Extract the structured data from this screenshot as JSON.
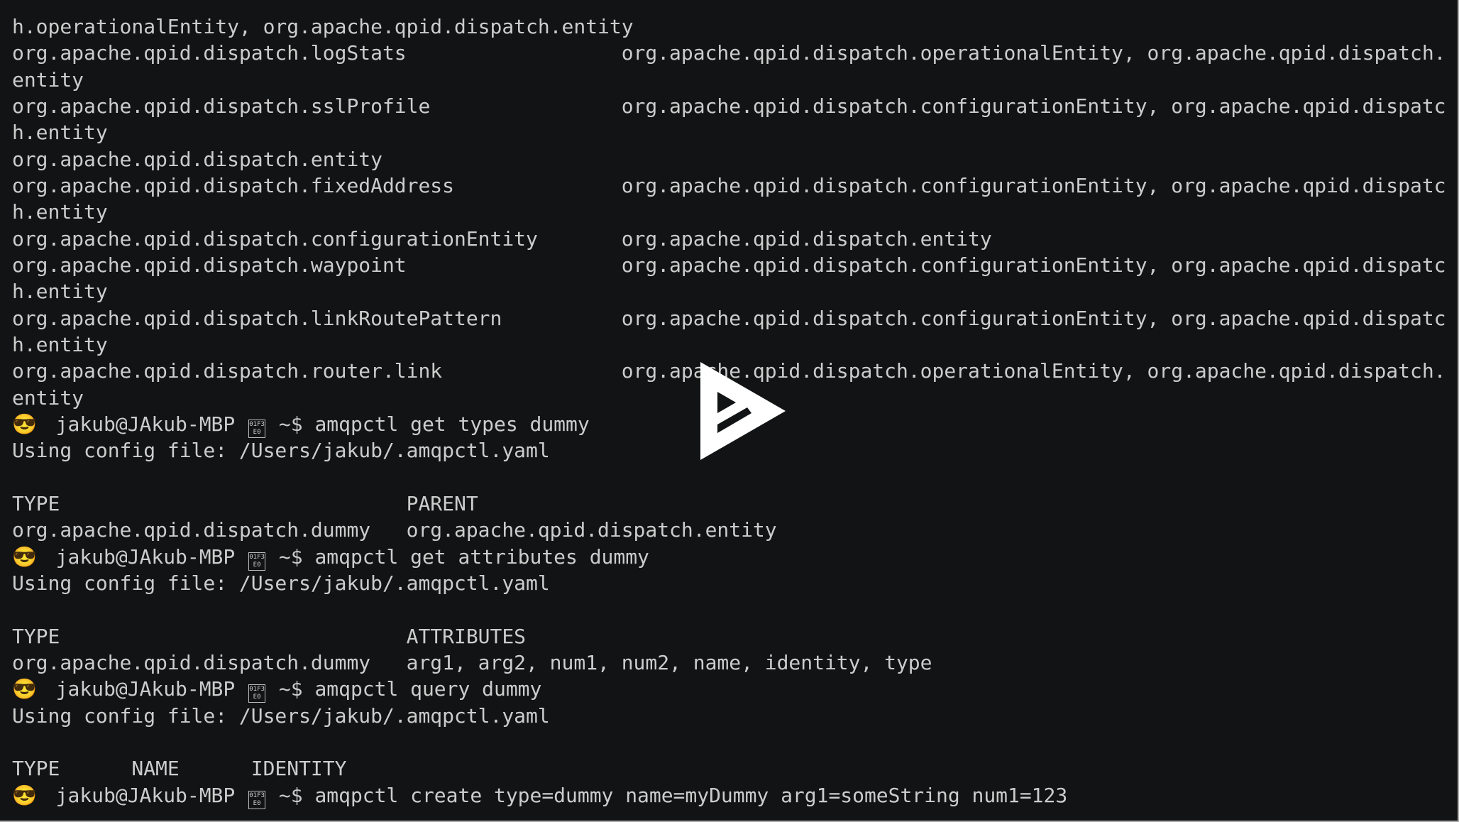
{
  "terminal": {
    "prompt": {
      "emoji": "😎",
      "user_host": "jakub@JAkub-MBP",
      "home_glyph_code": "01F3E0",
      "cwd_symbol": "~$"
    },
    "lines": [
      {
        "kind": "text",
        "text": "h.operationalEntity, org.apache.qpid.dispatch.entity"
      },
      {
        "kind": "text",
        "text": "org.apache.qpid.dispatch.logStats                  org.apache.qpid.dispatch.operationalEntity, org.apache.qpid.dispatch."
      },
      {
        "kind": "text",
        "text": "entity"
      },
      {
        "kind": "text",
        "text": "org.apache.qpid.dispatch.sslProfile                org.apache.qpid.dispatch.configurationEntity, org.apache.qpid.dispatc"
      },
      {
        "kind": "text",
        "text": "h.entity"
      },
      {
        "kind": "text",
        "text": "org.apache.qpid.dispatch.entity"
      },
      {
        "kind": "text",
        "text": "org.apache.qpid.dispatch.fixedAddress              org.apache.qpid.dispatch.configurationEntity, org.apache.qpid.dispatc"
      },
      {
        "kind": "text",
        "text": "h.entity"
      },
      {
        "kind": "text",
        "text": "org.apache.qpid.dispatch.configurationEntity       org.apache.qpid.dispatch.entity"
      },
      {
        "kind": "text",
        "text": "org.apache.qpid.dispatch.waypoint                  org.apache.qpid.dispatch.configurationEntity, org.apache.qpid.dispatc"
      },
      {
        "kind": "text",
        "text": "h.entity"
      },
      {
        "kind": "text",
        "text": "org.apache.qpid.dispatch.linkRoutePattern          org.apache.qpid.dispatch.configurationEntity, org.apache.qpid.dispatc"
      },
      {
        "kind": "text",
        "text": "h.entity"
      },
      {
        "kind": "text",
        "text": "org.apache.qpid.dispatch.router.link               org.apache.qpid.dispatch.operationalEntity, org.apache.qpid.dispatch."
      },
      {
        "kind": "text",
        "text": "entity"
      },
      {
        "kind": "prompt",
        "command": "amqpctl get types dummy"
      },
      {
        "kind": "text",
        "text": "Using config file: /Users/jakub/.amqpctl.yaml"
      },
      {
        "kind": "text",
        "text": ""
      },
      {
        "kind": "text",
        "text": "TYPE                             PARENT"
      },
      {
        "kind": "text",
        "text": "org.apache.qpid.dispatch.dummy   org.apache.qpid.dispatch.entity"
      },
      {
        "kind": "prompt",
        "command": "amqpctl get attributes dummy"
      },
      {
        "kind": "text",
        "text": "Using config file: /Users/jakub/.amqpctl.yaml"
      },
      {
        "kind": "text",
        "text": ""
      },
      {
        "kind": "text",
        "text": "TYPE                             ATTRIBUTES"
      },
      {
        "kind": "text",
        "text": "org.apache.qpid.dispatch.dummy   arg1, arg2, num1, num2, name, identity, type"
      },
      {
        "kind": "prompt",
        "command": "amqpctl query dummy"
      },
      {
        "kind": "text",
        "text": "Using config file: /Users/jakub/.amqpctl.yaml"
      },
      {
        "kind": "text",
        "text": ""
      },
      {
        "kind": "text",
        "text": "TYPE      NAME      IDENTITY"
      },
      {
        "kind": "prompt",
        "command": "amqpctl create type=dummy name=myDummy arg1=someString num1=123"
      }
    ]
  },
  "player": {
    "play_button_icon": "asciinema-play-icon"
  },
  "colors": {
    "background": "#121314",
    "foreground": "#cccccc",
    "border": "#a9a9aa",
    "play_icon": "#ffffff"
  }
}
